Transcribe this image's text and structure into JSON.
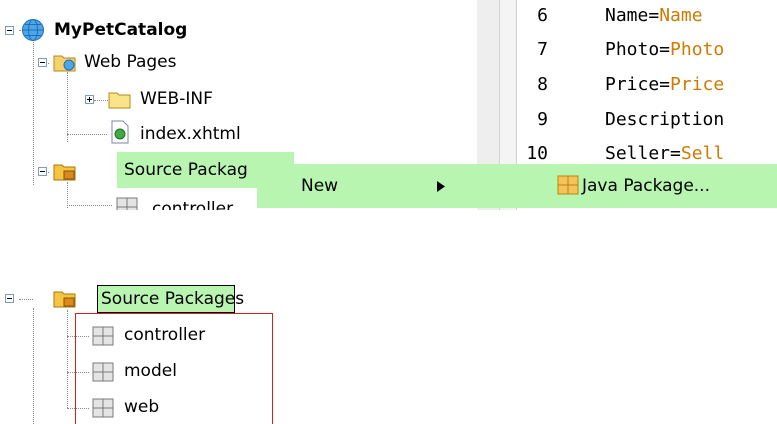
{
  "project_tree": {
    "project": "MyPetCatalog",
    "web_pages": "Web Pages",
    "web_inf": "WEB-INF",
    "index_file": "index.xhtml",
    "source_packages": "Source Packag",
    "controller_partial": "controller"
  },
  "editor": {
    "lines": [
      {
        "num": "6",
        "key": "Name=",
        "value": "Name"
      },
      {
        "num": "7",
        "key": "Photo=",
        "value": "Photo"
      },
      {
        "num": "8",
        "key": "Price=",
        "value": "Price"
      },
      {
        "num": "9",
        "key": "Description",
        "value": ""
      },
      {
        "num": "10",
        "key": "Seller=",
        "value": "Sell"
      }
    ]
  },
  "context_menu": {
    "new_label": "New",
    "java_package_label": "Java Package..."
  },
  "result_tree": {
    "source_packages": "Source Packages",
    "packages": [
      "controller",
      "model",
      "web"
    ]
  },
  "colors": {
    "highlight": "#b8f5b0",
    "code_value": "#ce7b00",
    "annotation_box": "#d81f1f"
  }
}
